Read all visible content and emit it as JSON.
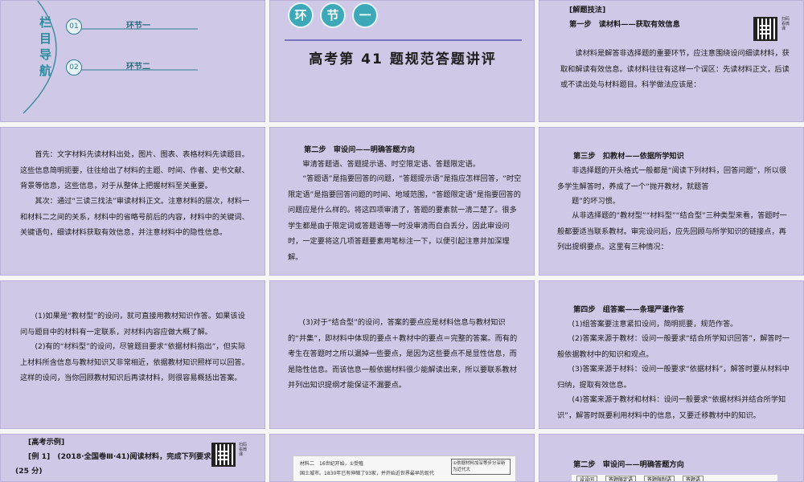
{
  "s1": {
    "nav_title": [
      "栏",
      "目",
      "导",
      "航"
    ],
    "items": [
      {
        "num": "01",
        "label": "环节一"
      },
      {
        "num": "02",
        "label": "环节二"
      }
    ]
  },
  "s2": {
    "badges": [
      "环",
      "节",
      "一"
    ],
    "title": "高考第 41 题规范答题讲评"
  },
  "s3": {
    "tag": "[解题技法]",
    "step": "第一步　读材料——获取有效信息",
    "para": "读材料是解答非选择题的重要环节，应注意围绕设问细读材料，获取和解读有效信息。读材料往往有这样一个误区：先读材料正文，后读或不读出处与材料题目。科学做法应该是：",
    "qr_text": "扫码看微课"
  },
  "s4": {
    "p1": "首先：文字材料先读材料出处，图片、图表、表格材料先读题目。这些信息简明扼要，往往给出了材料的主题、时间、作者、史书文献、背景等信息，这些信息，对于从整体上把握材料至关重要。",
    "p2": "其次：通过“三读三找法”审读材料正文。注意材料的层次，材料一和材料二之间的关系，材料中的省略号前后的内容，材料中的关键词、关键语句，细读材料获取有效信息，并注意材料中的隐性信息。"
  },
  "s5": {
    "step": "第二步　审设问——明确答题方向",
    "p1": "审清答题语、答题提示语、时空限定语、答题限定语。",
    "p2": "“答题语”是指要回答的问题，“答题提示语”是指应怎样回答，“时空限定语”是指要回答问题的时间、地域范围，“答题限定语”是指要回答的问题应是什么样的。将这四项审清了，答题的要素就一清二楚了。很多学生都是由于限定词或答题语等一时没审清而白白丢分，因此审设问时，一定要将这几项答题要素用笔标注一下，以便引起注意并加深理解。"
  },
  "s6": {
    "step": "第三步　扣教材——依据所学知识",
    "p1": "非选择题的开头格式一般都是“阅读下列材料，回答问题”，所以很多学生解答时，养成了一个“抛开教材，就题答",
    "p1b": "题”的坏习惯。",
    "p2": "从非选择题的“教材型”“材料型”“结合型”三种类型来看，答题时一般都要适当联系教材。审完设问后，应先回顾与所学知识的链接点，再列出提纲要点。这里有三种情况："
  },
  "s7": {
    "p1": "(1)如果是“教材型”的设问，就可直接用教材知识作答。如果该设问与题目中的材料有一定联系，对材料内容应做大概了解。",
    "p2": "(2)有的“材料型”的设问，尽管题目要求“依据材料指出”，但实际上材料所含信息与教材知识又非常相近，依据教材知识照样可以回答。这样的设问，当你回顾教材知识后再读材料，则很容易概括出答案。"
  },
  "s8": {
    "p1": "(3)对于“结合型”的设问，答案的要点应是材料信息与教材知识的“并集”，即材料中体现的要点＋教材中的要点＝完整的答案。而有的考生在答题时之所以漏掉一些要点，是因为这些要点不是显性信息，而是隐性信息。而该信息一般依据材料很少能解读出来，所以要联系教材并列出知识提纲才能保证不漏要点。"
  },
  "s9": {
    "step": "第四步　组答案——条理严谨作答",
    "l1": "(1)组答案要注意紧扣设问，简明扼要，规范作答。",
    "l2": "(2)答案来源于教材：设问一般要求“结合所学知识回答”，解答时一般依据教材中的知识和观点。",
    "l3": "(3)答案来源于材料：设问一般要求“依据材料”，解答时要从材料中归纳，提取有效信息。",
    "l4": "(4)答案来源于教材和材料：设问一般要求“依据材料并结合所学知识”，解答时既要利用材料中的信息，又要迁移教材中的知识。"
  },
  "s10": {
    "tag": "[高考示例]",
    "example": "[例 1]　(2018·全国卷Ⅲ·41)阅读材料，完成下列要求。",
    "score": "(25 分)",
    "qr_text": "扫码看微课"
  },
  "s11": {
    "line1": "材料二　16世纪开始，①受殖",
    "line1b": "国土城市。1830年已有伸缩了93家，并开始近世界最早的现代",
    "note": "①依据材料加深等步分深新为近代大"
  },
  "s12": {
    "step": "第二步　审设问——明确答题方向",
    "boxes": [
      "设设问",
      "答题限定语",
      "答题限制语",
      "答题语"
    ]
  }
}
